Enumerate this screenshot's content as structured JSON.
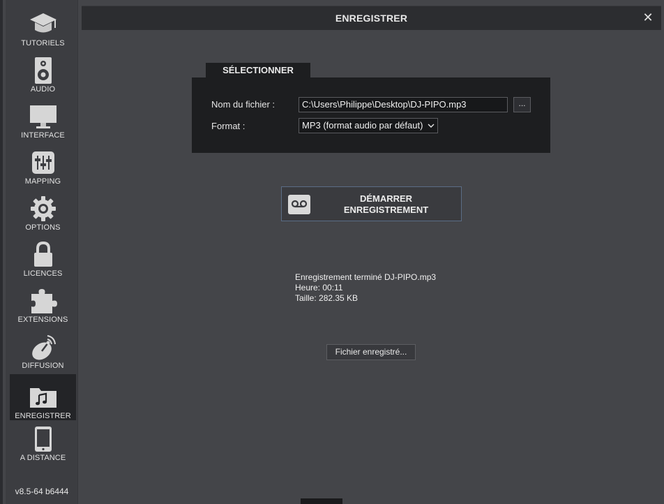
{
  "window": {
    "title": "ENREGISTRER",
    "close_label": "✕"
  },
  "sidebar": {
    "items": [
      {
        "label": "TUTORIELS",
        "icon": "graduation-cap-icon"
      },
      {
        "label": "AUDIO",
        "icon": "speaker-icon"
      },
      {
        "label": "INTERFACE",
        "icon": "monitor-icon"
      },
      {
        "label": "MAPPING",
        "icon": "sliders-icon"
      },
      {
        "label": "OPTIONS",
        "icon": "gear-icon"
      },
      {
        "label": "LICENCES",
        "icon": "lock-icon"
      },
      {
        "label": "EXTENSIONS",
        "icon": "puzzle-icon"
      },
      {
        "label": "DIFFUSION",
        "icon": "satellite-dish-icon"
      },
      {
        "label": "ENREGISTRER",
        "icon": "music-folder-icon",
        "active": true
      },
      {
        "label": "A DISTANCE",
        "icon": "tablet-icon"
      }
    ],
    "version": "v8.5-64 b6444"
  },
  "select_panel": {
    "tab_label": "SÉLECTIONNER",
    "filename_label": "Nom du fichier :",
    "filename_value": "C:\\Users\\Philippe\\Desktop\\DJ-PIPO.mp3",
    "browse_label": "...",
    "format_label": "Format :",
    "format_value": "MP3 (format audio par défaut)"
  },
  "start_button": {
    "line1": "DÉMARRER",
    "line2": "ENREGISTREMENT",
    "icon": "cassette-icon"
  },
  "status": {
    "line1": "Enregistrement terminé DJ-PIPO.mp3",
    "line2": "Heure: 00:11",
    "line3": "Taille: 282.35 KB"
  },
  "saved_button": {
    "label": "Fichier enregistré..."
  },
  "colors": {
    "background": "#444549",
    "sidebar": "#3c3d41",
    "panel": "#1d1e20",
    "accent_border": "#5b6d86"
  }
}
